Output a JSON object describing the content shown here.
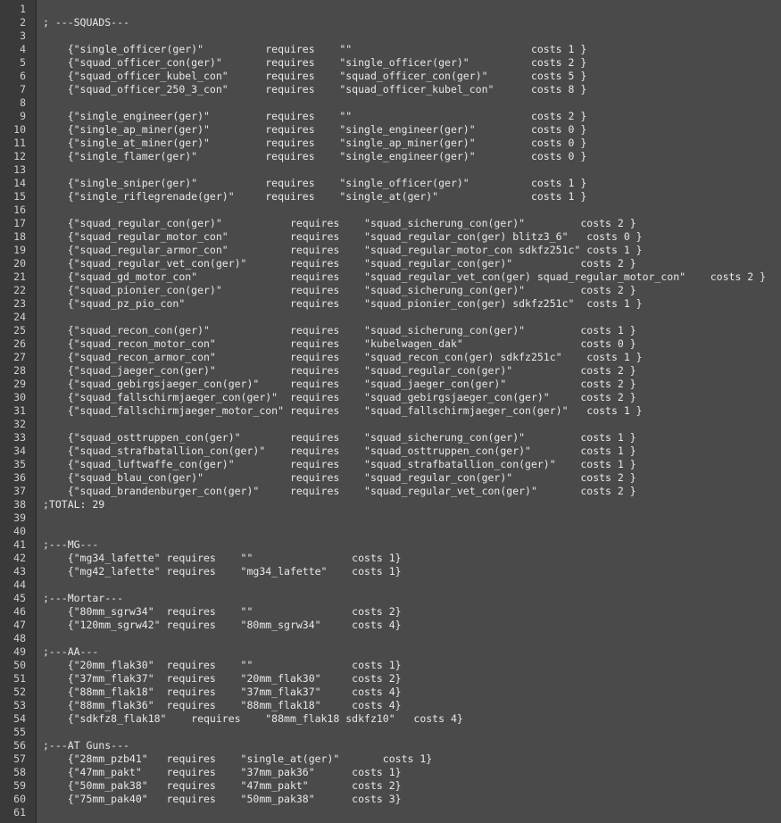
{
  "lines": [
    "",
    "; ---SQUADS---",
    "",
    "    {\"single_officer(ger)\"          requires    \"\"                             costs 1 }",
    "    {\"squad_officer_con(ger)\"       requires    \"single_officer(ger)\"          costs 2 }",
    "    {\"squad_officer_kubel_con\"      requires    \"squad_officer_con(ger)\"       costs 5 }",
    "    {\"squad_officer_250_3_con\"      requires    \"squad_officer_kubel_con\"      costs 8 }",
    "",
    "    {\"single_engineer(ger)\"         requires    \"\"                             costs 2 }",
    "    {\"single_ap_miner(ger)\"         requires    \"single_engineer(ger)\"         costs 0 }",
    "    {\"single_at_miner(ger)\"         requires    \"single_ap_miner(ger)\"         costs 0 }",
    "    {\"single_flamer(ger)\"           requires    \"single_engineer(ger)\"         costs 0 }",
    "",
    "    {\"single_sniper(ger)\"           requires    \"single_officer(ger)\"          costs 1 }",
    "    {\"single_riflegrenade(ger)\"     requires    \"single_at(ger)\"               costs 1 }",
    "",
    "    {\"squad_regular_con(ger)\"           requires    \"squad_sicherung_con(ger)\"         costs 2 }",
    "    {\"squad_regular_motor_con\"          requires    \"squad_regular_con(ger) blitz3_6\"   costs 0 }",
    "    {\"squad_regular_armor_con\"          requires    \"squad_regular_motor_con sdkfz251c\" costs 1 }",
    "    {\"squad_regular_vet_con(ger)\"       requires    \"squad_regular_con(ger)\"           costs 2 }",
    "    {\"squad_gd_motor_con\"               requires    \"squad_regular_vet_con(ger) squad_regular_motor_con\"    costs 2 }",
    "    {\"squad_pionier_con(ger)\"           requires    \"squad_sicherung_con(ger)\"         costs 2 }",
    "    {\"squad_pz_pio_con\"                 requires    \"squad_pionier_con(ger) sdkfz251c\"  costs 1 }",
    "",
    "    {\"squad_recon_con(ger)\"             requires    \"squad_sicherung_con(ger)\"         costs 1 }",
    "    {\"squad_recon_motor_con\"            requires    \"kubelwagen_dak\"                   costs 0 }",
    "    {\"squad_recon_armor_con\"            requires    \"squad_recon_con(ger) sdkfz251c\"    costs 1 }",
    "    {\"squad_jaeger_con(ger)\"            requires    \"squad_regular_con(ger)\"           costs 2 }",
    "    {\"squad_gebirgsjaeger_con(ger)\"     requires    \"squad_jaeger_con(ger)\"            costs 2 }",
    "    {\"squad_fallschirmjaeger_con(ger)\"  requires    \"squad_gebirgsjaeger_con(ger)\"     costs 2 }",
    "    {\"squad_fallschirmjaeger_motor_con\" requires    \"squad_fallschirmjaeger_con(ger)\"   costs 1 }",
    "",
    "    {\"squad_osttruppen_con(ger)\"        requires    \"squad_sicherung_con(ger)\"         costs 1 }",
    "    {\"squad_strafbatallion_con(ger)\"    requires    \"squad_osttruppen_con(ger)\"        costs 1 }",
    "    {\"squad_luftwaffe_con(ger)\"         requires    \"squad_strafbatallion_con(ger)\"    costs 1 }",
    "    {\"squad_blau_con(ger)\"              requires    \"squad_regular_con(ger)\"           costs 2 }",
    "    {\"squad_brandenburger_con(ger)\"     requires    \"squad_regular_vet_con(ger)\"       costs 2 }",
    ";TOTAL: 29",
    "",
    "",
    ";---MG---",
    "    {\"mg34_lafette\" requires    \"\"                costs 1}",
    "    {\"mg42_lafette\" requires    \"mg34_lafette\"    costs 1}",
    "",
    ";---Mortar---",
    "    {\"80mm_sgrw34\"  requires    \"\"                costs 2}",
    "    {\"120mm_sgrw42\" requires    \"80mm_sgrw34\"     costs 4}",
    "",
    ";---AA---",
    "    {\"20mm_flak30\"  requires    \"\"                costs 1}",
    "    {\"37mm_flak37\"  requires    \"20mm_flak30\"     costs 2}",
    "    {\"88mm_flak18\"  requires    \"37mm_flak37\"     costs 4}",
    "    {\"88mm_flak36\"  requires    \"88mm_flak18\"     costs 4}",
    "    {\"sdkfz8_flak18\"    requires    \"88mm_flak18 sdkfz10\"   costs 4}",
    "",
    ";---AT Guns---",
    "    {\"28mm_pzb41\"   requires    \"single_at(ger)\"       costs 1}",
    "    {\"47mm_pakt\"    requires    \"37mm_pak36\"      costs 1}",
    "    {\"50mm_pak38\"   requires    \"47mm_pakt\"       costs 2}",
    "    {\"75mm_pak40\"   requires    \"50mm_pak38\"      costs 3}",
    ""
  ]
}
